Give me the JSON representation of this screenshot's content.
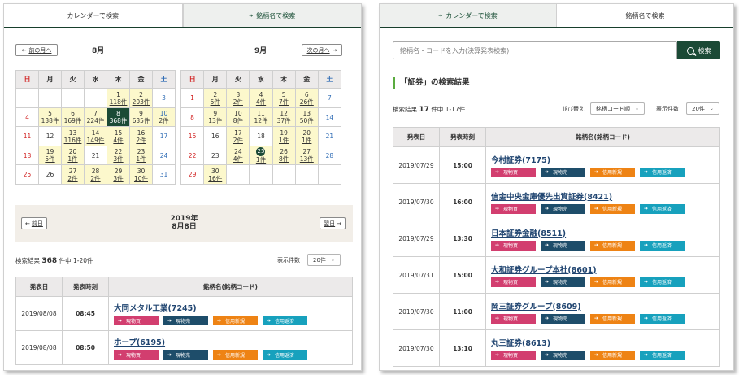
{
  "tabs": {
    "calendar": "カレンダーで検索",
    "name": "銘柄名で検索"
  },
  "left": {
    "prev_label": "前の月へ",
    "next_label": "次の月へ",
    "weekdays": [
      "日",
      "月",
      "火",
      "水",
      "木",
      "金",
      "土"
    ],
    "month1": {
      "title": "8月",
      "weeks": [
        [
          null,
          null,
          null,
          null,
          {
            "d": "1",
            "c": "118件"
          },
          {
            "d": "2",
            "c": "203件"
          },
          {
            "d": "3"
          }
        ],
        [
          {
            "d": "4"
          },
          {
            "d": "5",
            "c": "138件"
          },
          {
            "d": "6",
            "c": "169件"
          },
          {
            "d": "7",
            "c": "224件"
          },
          {
            "d": "8",
            "c": "368件"
          },
          {
            "d": "9",
            "c": "635件"
          },
          {
            "d": "10",
            "c": "2件"
          }
        ],
        [
          {
            "d": "11"
          },
          {
            "d": "12"
          },
          {
            "d": "13",
            "c": "116件"
          },
          {
            "d": "14",
            "c": "149件"
          },
          {
            "d": "15",
            "c": "4件"
          },
          {
            "d": "16",
            "c": "2件"
          },
          {
            "d": "17"
          }
        ],
        [
          {
            "d": "18"
          },
          {
            "d": "19",
            "c": "5件"
          },
          {
            "d": "20",
            "c": "1件"
          },
          {
            "d": "21"
          },
          {
            "d": "22",
            "c": "3件"
          },
          {
            "d": "23",
            "c": "1件"
          },
          {
            "d": "24"
          }
        ],
        [
          {
            "d": "25"
          },
          {
            "d": "26"
          },
          {
            "d": "27",
            "c": "2件"
          },
          {
            "d": "28",
            "c": "2件"
          },
          {
            "d": "29",
            "c": "3件"
          },
          {
            "d": "30",
            "c": "10件"
          },
          {
            "d": "31"
          }
        ]
      ]
    },
    "month2": {
      "title": "9月",
      "weeks": [
        [
          {
            "d": "1"
          },
          {
            "d": "2",
            "c": "5件"
          },
          {
            "d": "3",
            "c": "2件"
          },
          {
            "d": "4",
            "c": "4件"
          },
          {
            "d": "5",
            "c": "7件"
          },
          {
            "d": "6",
            "c": "26件"
          },
          {
            "d": "7"
          }
        ],
        [
          {
            "d": "8"
          },
          {
            "d": "9",
            "c": "13件"
          },
          {
            "d": "10",
            "c": "8件"
          },
          {
            "d": "11",
            "c": "12件"
          },
          {
            "d": "12",
            "c": "37件"
          },
          {
            "d": "13",
            "c": "50件"
          },
          {
            "d": "14"
          }
        ],
        [
          {
            "d": "15"
          },
          {
            "d": "16"
          },
          {
            "d": "17",
            "c": "2件"
          },
          {
            "d": "18"
          },
          {
            "d": "19",
            "c": "1件"
          },
          {
            "d": "20",
            "c": "1件"
          },
          {
            "d": "21"
          }
        ],
        [
          {
            "d": "22"
          },
          {
            "d": "23"
          },
          {
            "d": "24",
            "c": "4件"
          },
          {
            "d": "25",
            "c": "1件"
          },
          {
            "d": "26",
            "c": "8件"
          },
          {
            "d": "27",
            "c": "13件"
          },
          {
            "d": "28"
          }
        ],
        [
          {
            "d": "29"
          },
          {
            "d": "30",
            "c": "16件"
          },
          null,
          null,
          null,
          null,
          null
        ]
      ]
    },
    "date_year": "2019年",
    "date_day": "8月8日",
    "prev_day": "前日",
    "next_day": "翌日",
    "count_prefix": "検索結果",
    "count": "368",
    "count_suffix": "件中 1-20件",
    "per_page_label": "表示件数",
    "per_page_value": "20件",
    "rows": [
      {
        "date": "2019/08/08",
        "time": "08:45",
        "name": "大同メタル工業(7245)"
      },
      {
        "date": "2019/08/08",
        "time": "08:50",
        "name": "ホープ(6195)"
      }
    ]
  },
  "right": {
    "search_placeholder": "銘柄名・コードを入力(決算発表検索)",
    "search_button": "検索",
    "result_title": "「証券」の検索結果",
    "count_prefix": "検索結果",
    "count": "17",
    "count_suffix": "件中 1-17件",
    "sort_label": "並び替え",
    "sort_value": "銘柄コード順",
    "per_page_label": "表示件数",
    "per_page_value": "20件",
    "rows": [
      {
        "date": "2019/07/29",
        "time": "15:00",
        "name": "今村証券(7175)"
      },
      {
        "date": "2019/07/30",
        "time": "16:00",
        "name": "信金中央金庫優先出資証券(8421)"
      },
      {
        "date": "2019/07/29",
        "time": "13:30",
        "name": "日本証券金融(8511)"
      },
      {
        "date": "2019/07/31",
        "time": "15:00",
        "name": "大和証券グループ本社(8601)"
      },
      {
        "date": "2019/07/30",
        "time": "11:00",
        "name": "岡三証券グループ(8609)"
      },
      {
        "date": "2019/07/30",
        "time": "13:10",
        "name": "丸三証券(8613)"
      }
    ]
  },
  "table_headers": {
    "date": "発表日",
    "time": "発表時刻",
    "name": "銘柄名(銘柄コード)"
  },
  "actions": [
    "現物買",
    "現物売",
    "信用新規",
    "信用返済"
  ],
  "colors": {
    "brand": "#1b4a36",
    "highlight": "#fcf8cc",
    "buy": "#d23e6f",
    "sell": "#1e4d6a",
    "margin_new": "#ee8314",
    "margin_close": "#17a1bd"
  }
}
